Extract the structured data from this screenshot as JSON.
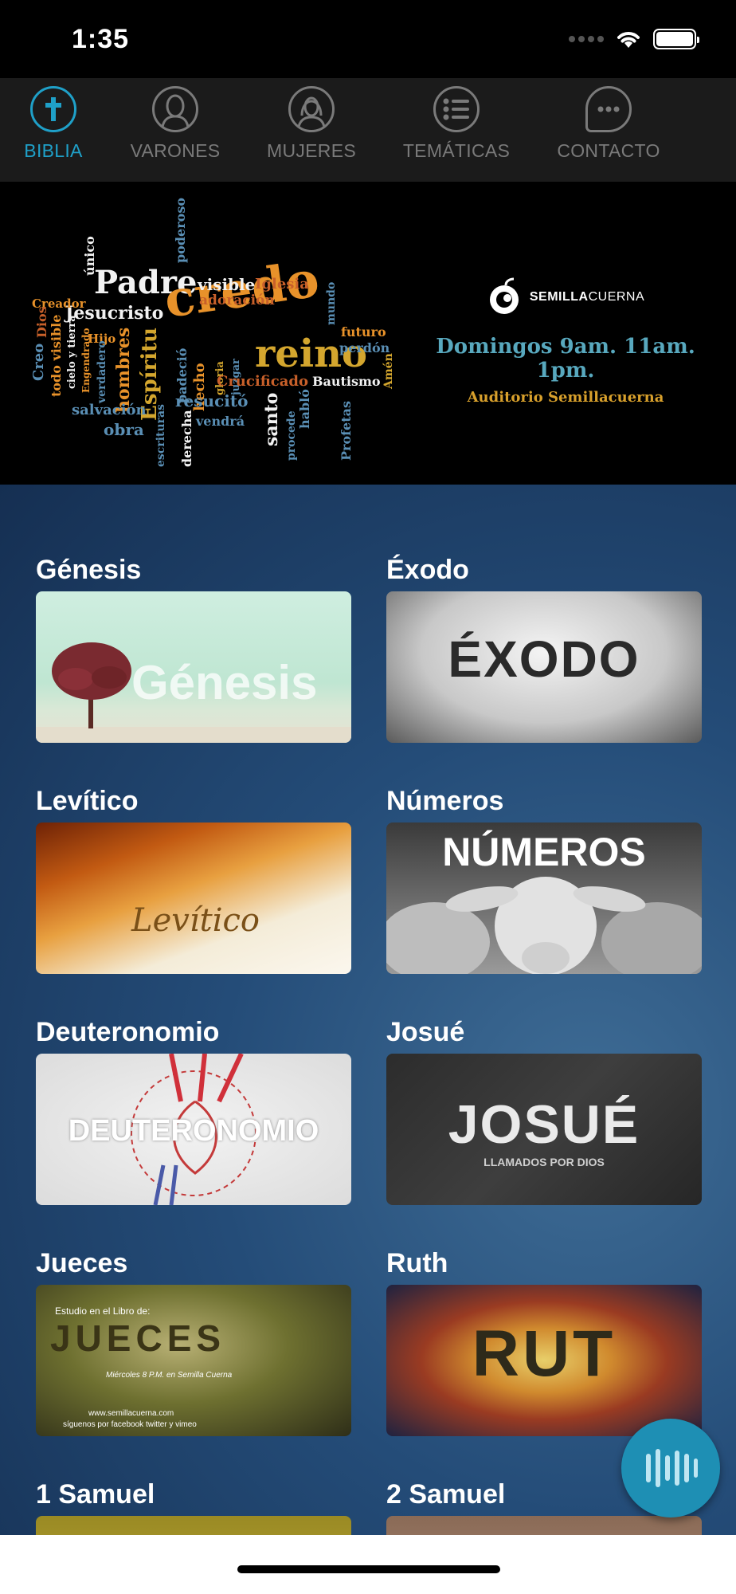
{
  "status": {
    "time": "1:35"
  },
  "tabs": [
    {
      "label": "BIBLIA",
      "icon": "cross-icon",
      "active": true
    },
    {
      "label": "VARONES",
      "icon": "man-icon",
      "active": false
    },
    {
      "label": "MUJERES",
      "icon": "woman-icon",
      "active": false
    },
    {
      "label": "TEMÁTICAS",
      "icon": "list-icon",
      "active": false
    },
    {
      "label": "CONTACTO",
      "icon": "chat-icon",
      "active": false
    }
  ],
  "banner": {
    "words": {
      "padre": "Padre",
      "credo": "credo",
      "reino": "reino",
      "jesucristo": "Jesucristo",
      "visible": "visible",
      "iglesia": "Iglesia",
      "adoracion": "adoración",
      "unico": "único",
      "creador": "Creador",
      "dios": "Dios",
      "creo": "Creo",
      "todo": "todo visible",
      "cielo": "cielo y tierra",
      "hijo": "Hijo",
      "engendrado": "Engendrado",
      "verdadero": "verdadero",
      "hombres": "hombres",
      "espiritu": "Espíritu",
      "padece": "padeció",
      "hecho": "hecho",
      "gloria": "gloria",
      "juzgar": "juzgar",
      "crucificado": "Crucificado",
      "bautismo": "Bautismo",
      "salvacion": "salvación",
      "resucito": "resucitó",
      "obra": "obra",
      "vendra": "vendrá",
      "escrituras": "escrituras",
      "derecha": "derecha",
      "santo": "santo",
      "procede": "procede",
      "hablo": "habló",
      "profetas": "Profetas",
      "futuro": "futuro",
      "perdon": "perdón",
      "mundo": "mundo",
      "amen": "Amén",
      "poderoso": "poderoso"
    },
    "brand_bold": "SEMILLA",
    "brand_light": "CUERNA",
    "schedule": "Domingos 9am. 11am. 1pm.",
    "venue": "Auditorio Semillacuerna"
  },
  "books": [
    {
      "title": "Génesis",
      "thumb_text": "Génesis"
    },
    {
      "title": "Éxodo",
      "thumb_text": "ÉXODO"
    },
    {
      "title": "Levítico",
      "thumb_text": "Levítico"
    },
    {
      "title": "Números",
      "thumb_text": "NÚMEROS"
    },
    {
      "title": "Deuteronomio",
      "thumb_text": "DEUTERONOMIO"
    },
    {
      "title": "Josué",
      "thumb_text": "JOSUÉ",
      "thumb_sub": "LLAMADOS POR DIOS"
    },
    {
      "title": "Jueces",
      "thumb_text": "JUECES",
      "thumb_top": "Estudio en el Libro de:",
      "thumb_mid": "Miércoles 8 P.M.  en Semilla Cuerna",
      "thumb_url": "www.semillacuerna.com",
      "thumb_social": "síguenos por facebook twitter y vimeo"
    },
    {
      "title": "Ruth",
      "thumb_text": "RUT"
    },
    {
      "title": "1 Samuel"
    },
    {
      "title": "2 Samuel"
    }
  ],
  "colors": {
    "accent": "#1fa0c8",
    "tab_inactive": "#7a7a7a",
    "fab": "#1e8fb4"
  },
  "fab": {
    "icon": "audio-bars-icon"
  }
}
